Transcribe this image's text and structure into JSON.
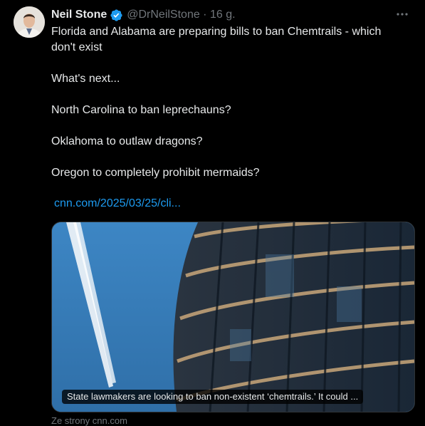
{
  "tweet": {
    "author_name": "Neil Stone",
    "handle_time": "@DrNeilStone · 16 g.",
    "paragraphs": [
      "Florida and Alabama are preparing bills to ban Chemtrails  - which don't exist",
      "What's next...",
      "North Carolina to ban leprechauns?",
      "Oklahoma to outlaw dragons?",
      "Oregon to completely prohibit mermaids?"
    ],
    "link_text": "cnn.com/2025/03/25/cli...",
    "card_caption": "State lawmakers are looking to ban non-existent ‘chemtrails.’ It could ...",
    "source_label": "Ze strony cnn.com"
  },
  "icons": {
    "verified": "verified-badge-icon",
    "more": "more-options-icon"
  },
  "colors": {
    "background": "#000000",
    "text": "#e7e9ea",
    "secondary_text": "#71767b",
    "link": "#1d9bf0",
    "verified_badge": "#1d9bf0"
  }
}
